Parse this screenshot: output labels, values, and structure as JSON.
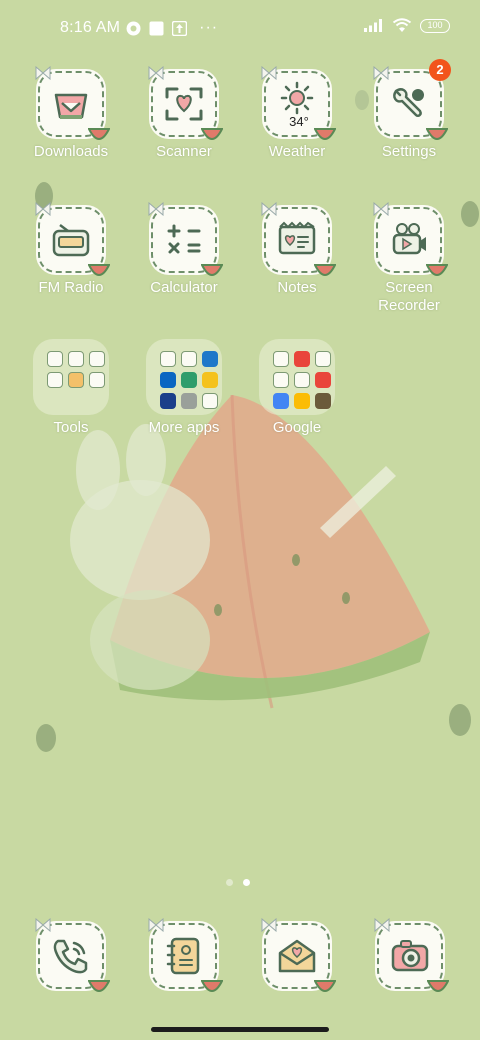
{
  "status_bar": {
    "time": "8:16 AM",
    "battery": "100",
    "notification_icons": [
      "camera-app-notification-icon",
      "square-notification-icon",
      "upload-notification-icon",
      "more-dots-icon"
    ],
    "more": "···"
  },
  "apps_row1": [
    {
      "label": "Downloads",
      "icon": "download-tray-icon"
    },
    {
      "label": "Scanner",
      "icon": "scanner-frame-icon"
    },
    {
      "label": "Weather",
      "icon": "sun-icon",
      "temp": "34°"
    },
    {
      "label": "Settings",
      "icon": "wrench-icon",
      "badge": "2"
    }
  ],
  "apps_row2": [
    {
      "label": "FM Radio",
      "icon": "radio-icon"
    },
    {
      "label": "Calculator",
      "icon": "calculator-icon"
    },
    {
      "label": "Notes",
      "icon": "notepad-icon"
    },
    {
      "label": "Screen Recorder",
      "label_line1": "Screen",
      "label_line2": "Recorder",
      "icon": "video-camera-icon"
    }
  ],
  "folders": [
    {
      "label": "Tools"
    },
    {
      "label": "More apps"
    },
    {
      "label": "Google"
    }
  ],
  "dock": [
    {
      "name": "phone",
      "icon": "phone-icon"
    },
    {
      "name": "contacts",
      "icon": "notebook-icon"
    },
    {
      "name": "messages",
      "icon": "envelope-icon"
    },
    {
      "name": "camera",
      "icon": "camera-icon"
    }
  ],
  "page_indicator": {
    "pages": 2,
    "current": 2
  },
  "colors": {
    "wallpaper": "#c8d9a2",
    "badge": "#f2541b",
    "icon_border": "#6e8f6a",
    "watermelon": "#e07a6a"
  }
}
